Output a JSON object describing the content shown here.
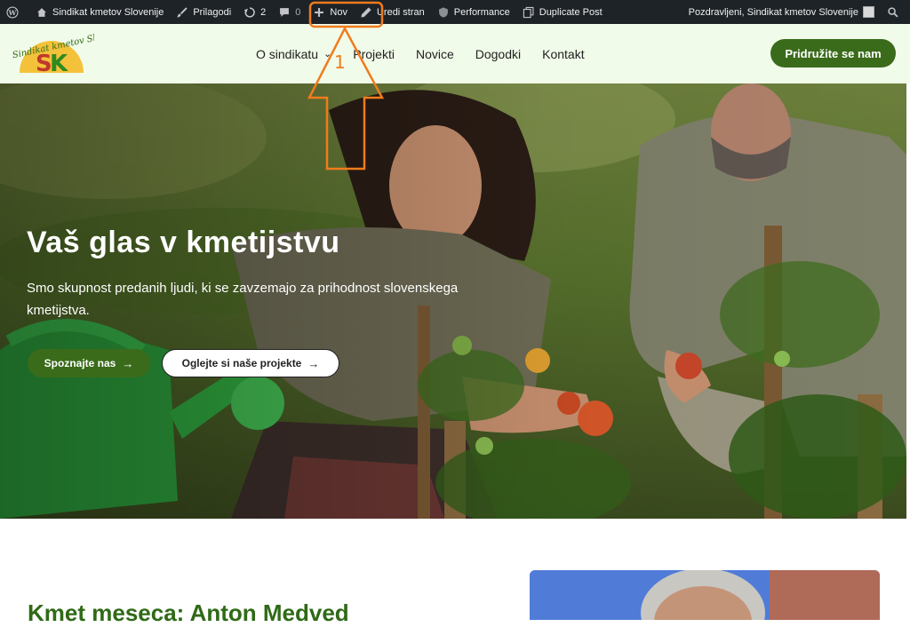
{
  "admin_bar": {
    "site_name": "Sindikat kmetov Slovenije",
    "customize": "Prilagodi",
    "updates_count": "2",
    "comments_count": "0",
    "new": "Nov",
    "edit_page": "Uredi stran",
    "performance": "Performance",
    "duplicate": "Duplicate Post",
    "greeting": "Pozdravljeni, Sindikat kmetov Slovenije"
  },
  "logo": {
    "text": "Sindikat kmetov Slovenije",
    "mark": "SK"
  },
  "nav": {
    "items": [
      "O sindikatu",
      "Projekti",
      "Novice",
      "Dogodki",
      "Kontakt"
    ],
    "cta": "Pridružite se nam"
  },
  "hero": {
    "title": "Vaš glas v kmetijstvu",
    "subtitle": "Smo skupnost predanih ljudi, ki se zavzemajo za prihodnost slovenskega kmetijstva.",
    "primary_button": "Spoznajte nas",
    "secondary_button": "Oglejte si naše projekte"
  },
  "section": {
    "title": "Kmet meseca: Anton Medved"
  },
  "annotation": {
    "label": "1"
  },
  "colors": {
    "admin_bg": "#1d2327",
    "header_bg": "#f1fbe9",
    "brand_green": "#3a6b1a",
    "title_green": "#2f6a16",
    "annotation_orange": "#f07c1d"
  },
  "icons": {
    "wordpress": "wordpress-icon",
    "home": "home-icon",
    "brush": "brush-icon",
    "updates": "refresh-icon",
    "comments": "comment-icon",
    "plus": "plus-icon",
    "pencil": "pencil-icon",
    "performance": "shield-icon",
    "duplicate": "copy-icon",
    "search": "search-icon"
  }
}
